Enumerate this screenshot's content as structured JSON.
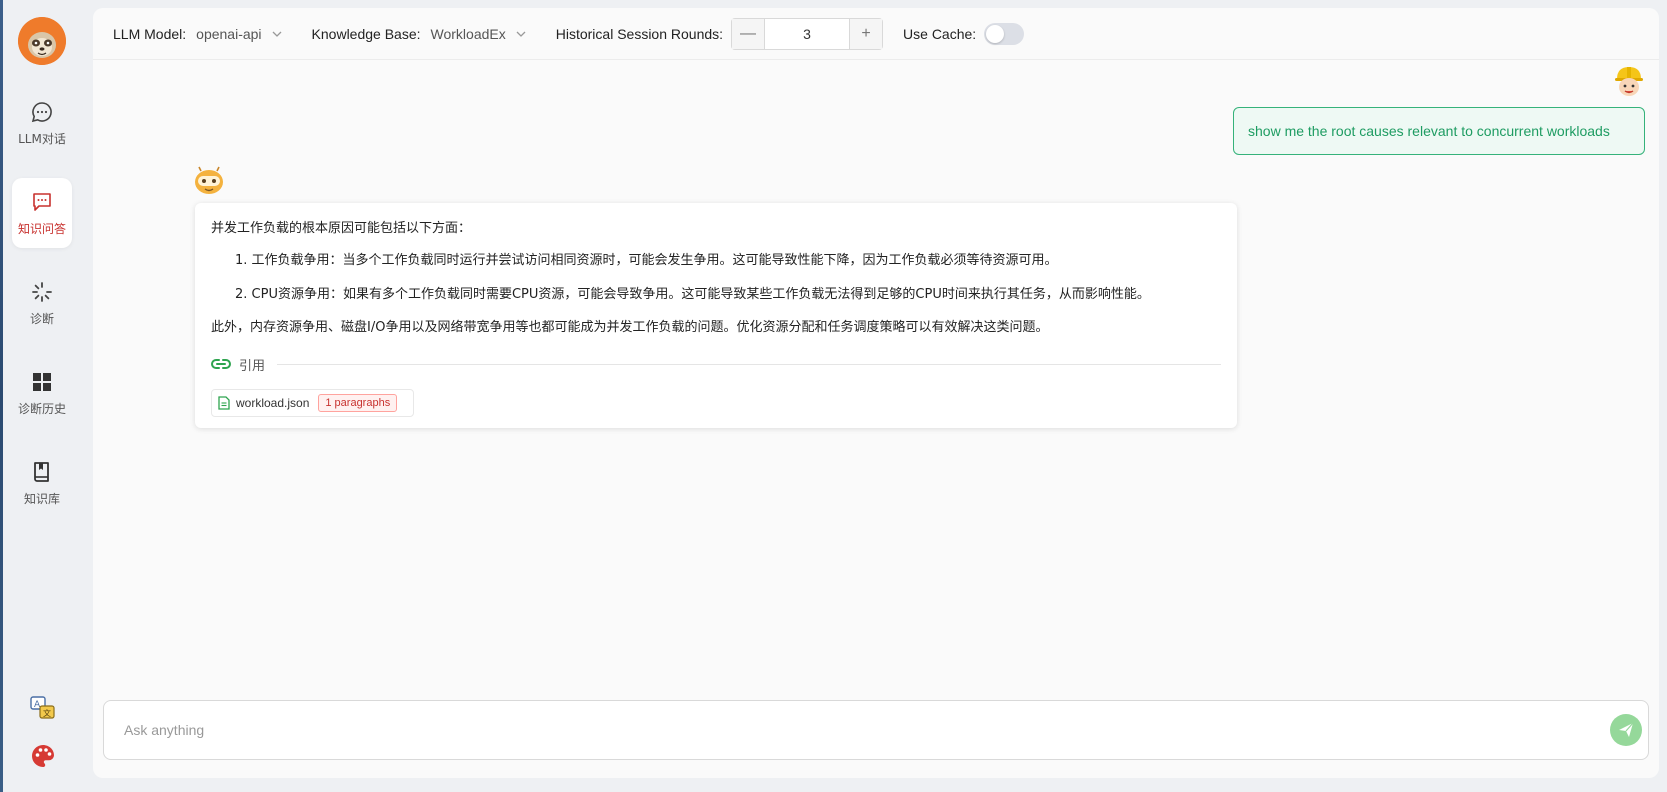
{
  "sidebar": {
    "items": [
      {
        "label": "LLM对话",
        "icon": "chat-icon"
      },
      {
        "label": "知识问答",
        "icon": "qa-message-icon",
        "active": true
      },
      {
        "label": "诊断",
        "icon": "spark-icon"
      },
      {
        "label": "诊断历史",
        "icon": "grid-icon"
      },
      {
        "label": "知识库",
        "icon": "book-icon"
      }
    ],
    "bottom_icons": [
      "translate-icon",
      "palette-icon"
    ]
  },
  "toolbar": {
    "llm_model_label": "LLM Model:",
    "llm_model_value": "openai-api",
    "knowledge_base_label": "Knowledge Base:",
    "knowledge_base_value": "WorkloadEx",
    "history_rounds_label": "Historical Session Rounds:",
    "history_rounds_value": "3",
    "decrement_symbol": "—",
    "increment_symbol": "+",
    "use_cache_label": "Use Cache:",
    "use_cache_on": false
  },
  "chat": {
    "user_message": "show me the root causes relevant to concurrent workloads",
    "bot": {
      "intro": "并发工作负载的根本原因可能包括以下方面：",
      "items": [
        "1. 工作负载争用：当多个工作负载同时运行并尝试访问相同资源时，可能会发生争用。这可能导致性能下降，因为工作负载必须等待资源可用。",
        "2. CPU资源争用：如果有多个工作负载同时需要CPU资源，可能会导致争用。这可能导致某些工作负载无法得到足够的CPU时间来执行其任务，从而影响性能。"
      ],
      "conclusion": "此外，内存资源争用、磁盘I/O争用以及网络带宽争用等也都可能成为并发工作负载的问题。优化资源分配和任务调度策略可以有效解决这类问题。",
      "reference_label": "引用",
      "reference_file": "workload.json",
      "reference_tag": "1 paragraphs"
    }
  },
  "input": {
    "placeholder": "Ask anything"
  },
  "colors": {
    "accent_red": "#c8322f",
    "user_bubble_border": "#35b27a",
    "send_button": "#95d89a"
  }
}
